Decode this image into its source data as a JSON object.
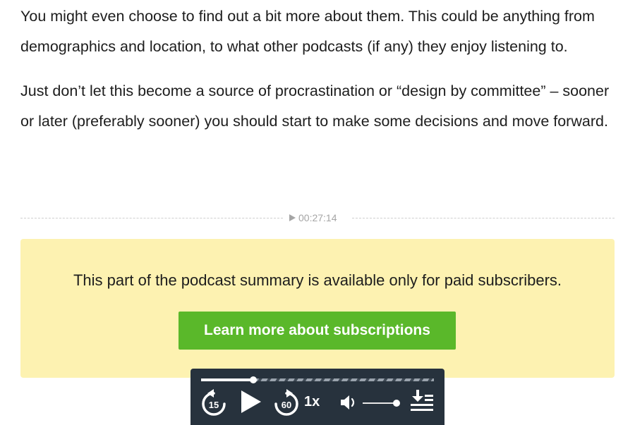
{
  "article": {
    "paragraphs": [
      "You might even choose to find out a bit more about them. This could be anything from demographics and location, to what other podcasts (if any) they enjoy listening to.",
      "Just don’t let this become a source of procrastination or “design by committee” – sooner or later (preferably sooner) you should start to make some decisions and move forward."
    ]
  },
  "timestamp": {
    "icon": "play-triangle-icon",
    "label": "00:27:14"
  },
  "paywall": {
    "message": "This part of the podcast summary is available only for paid subscribers.",
    "button_label": "Learn more about subscriptions",
    "background_color": "#fdf2b1",
    "button_color": "#5ab82a"
  },
  "player": {
    "background_color": "#27323d",
    "progress_fraction": 0.225,
    "rewind_seconds": "15",
    "forward_seconds": "60",
    "speed_label": "1x",
    "volume_fraction": 0.95,
    "icons": [
      "rewind-15-icon",
      "play-icon",
      "forward-60-icon",
      "volume-icon",
      "playlist-download-icon"
    ]
  }
}
